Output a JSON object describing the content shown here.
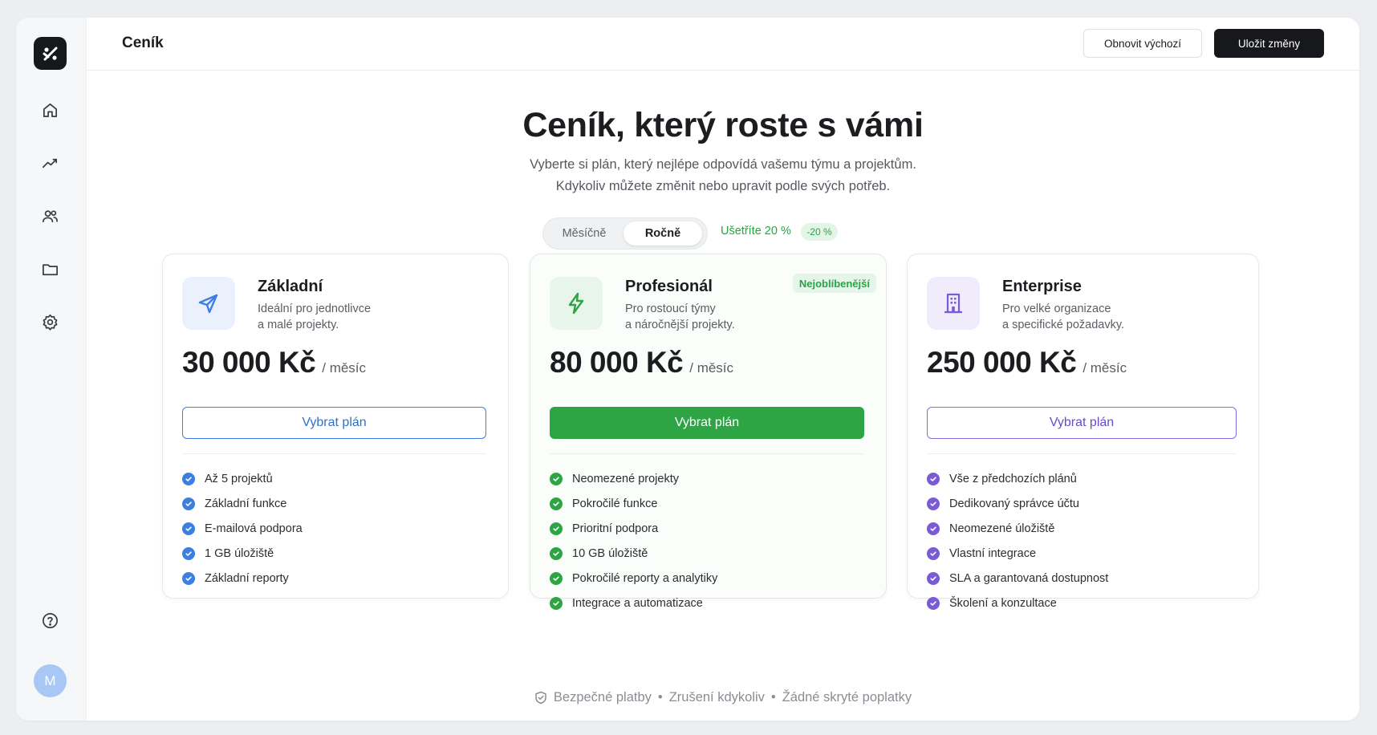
{
  "header": {
    "title": "Ceník",
    "reset_label": "Obnovit výchozí",
    "save_label": "Uložit změny"
  },
  "sidebar": {
    "items": [
      {
        "icon": "home-icon"
      },
      {
        "icon": "trend-icon"
      },
      {
        "icon": "users-icon"
      },
      {
        "icon": "folder-icon"
      },
      {
        "icon": "gear-icon"
      }
    ],
    "help_icon": "help-icon",
    "avatar_initial": "M"
  },
  "hero": {
    "title": "Ceník, který roste s vámi",
    "subtitle_line1": "Vyberte si plán, který nejlépe odpovídá vašemu týmu a projektům.",
    "subtitle_line2": "Kdykoliv můžete změnit nebo upravit podle svých potřeb."
  },
  "billing": {
    "monthly_label": "Měsíčně",
    "yearly_label": "Ročně",
    "selected": "Ročně",
    "save_text": "Ušetříte 20 %",
    "save_badge": "-20 %"
  },
  "plans": [
    {
      "name": "Základní",
      "desc_line1": "Ideální pro jednotlivce",
      "desc_line2": "a malé projekty.",
      "price": "30 000 Kč",
      "period": "/ měsíc",
      "button": "Vybrat plán",
      "accent": "#3d7fe0",
      "icon": "paper-plane-icon",
      "features": [
        "Až 5 projektů",
        "Základní funkce",
        "E-mailová podpora",
        "1 GB úložiště",
        "Základní reporty"
      ]
    },
    {
      "name": "Profesionál",
      "desc_line1": "Pro rostoucí týmy",
      "desc_line2": "a náročnější projekty.",
      "price": "80 000 Kč",
      "period": "/ měsíc",
      "button": "Vybrat plán",
      "badge": "Nejoblíbenější",
      "accent": "#2ea544",
      "icon": "lightning-icon",
      "features": [
        "Neomezené projekty",
        "Pokročilé funkce",
        "Prioritní podpora",
        "10 GB úložiště",
        "Pokročilé reporty a analytiky",
        "Integrace a automatizace"
      ]
    },
    {
      "name": "Enterprise",
      "desc_line1": "Pro velké organizace",
      "desc_line2": "a specifické požadavky.",
      "price": "250 000 Kč",
      "period": "/ měsíc",
      "button": "Vybrat plán",
      "accent": "#7b5ad6",
      "icon": "building-icon",
      "features": [
        "Vše z předchozích plánů",
        "Dedikovaný správce účtu",
        "Neomezené úložiště",
        "Vlastní integrace",
        "SLA a garantovaná dostupnost",
        "Školení a konzultace"
      ]
    }
  ],
  "footer": {
    "item1": "Bezpečné platby",
    "item2": "Zrušení kdykoliv",
    "item3": "Žádné skryté poplatky",
    "separator": "•"
  }
}
